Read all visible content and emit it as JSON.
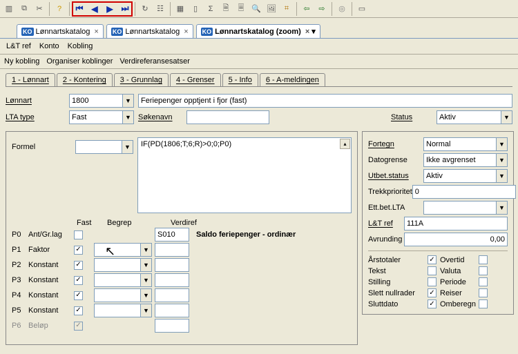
{
  "toolbar_icons": [
    "grid",
    "copy",
    "cut",
    "sep",
    "help",
    "sep",
    "first",
    "prev",
    "next",
    "last",
    "sep",
    "loop",
    "tree",
    "sep",
    "table",
    "chart",
    "sum",
    "doc",
    "page",
    "mag",
    "img",
    "bars",
    "sep",
    "back",
    "fwd",
    "sep",
    "stop",
    "sep",
    "dialog"
  ],
  "tabs": [
    {
      "label": "Lønnartskatalog",
      "active": false
    },
    {
      "label": "Lønnartskatalog",
      "active": false
    },
    {
      "label": "Lønnartskatalog (zoom)",
      "active": true
    }
  ],
  "menubar": [
    "L&T ref",
    "Konto",
    "Kobling"
  ],
  "subbar": [
    "Ny kobling",
    "Organiser koblinger",
    "Verdireferansesatser"
  ],
  "numtabs": [
    "1 - Lønnart",
    "2 - Kontering",
    "3 - Grunnlag",
    "4 - Grenser",
    "5 - Info",
    "6 - A-meldingen"
  ],
  "fields": {
    "lonnart_lbl": "Lønnart",
    "lonnart_val": "1800",
    "lonnart_desc": "Feriepenger opptjent i fjor (fast)",
    "ltatype_lbl": "LTA type",
    "ltatype_val": "Fast",
    "sokenavn_lbl": "Søkenavn",
    "sokenavn_val": "",
    "status_lbl": "Status",
    "status_val": "Aktiv",
    "formel_lbl": "Formel",
    "formel_sel": "",
    "formel_text": "IF(PD(1806;T;6;R)>0;0;P0)"
  },
  "grid_headers": {
    "fast": "Fast",
    "begrep": "Begrep",
    "verdiref": "Verdiref"
  },
  "prows": [
    {
      "code": "P0",
      "name": "Ant/Gr.lag",
      "chk": false,
      "begrep": null,
      "verdiref": "S010",
      "extra": "Saldo feriepenger - ordinær"
    },
    {
      "code": "P1",
      "name": "Faktor",
      "chk": true,
      "begrep": "",
      "verdiref": ""
    },
    {
      "code": "P2",
      "name": "Konstant",
      "chk": true,
      "begrep": "",
      "verdiref": ""
    },
    {
      "code": "P3",
      "name": "Konstant",
      "chk": true,
      "begrep": "",
      "verdiref": ""
    },
    {
      "code": "P4",
      "name": "Konstant",
      "chk": true,
      "begrep": "",
      "verdiref": ""
    },
    {
      "code": "P5",
      "name": "Konstant",
      "chk": true,
      "begrep": "",
      "verdiref": ""
    },
    {
      "code": "P6",
      "name": "Beløp",
      "chk": true,
      "grey": true,
      "begrep": null,
      "verdiref": "",
      "disabled": true
    }
  ],
  "right": {
    "fortegn_lbl": "Fortegn",
    "fortegn_val": "Normal",
    "datogrense_lbl": "Datogrense",
    "datogrense_val": "Ikke avgrenset",
    "utbet_lbl": "Utbet.status",
    "utbet_val": "Aktiv",
    "trekk_lbl": "Trekkprioritet",
    "trekk_val": "0",
    "ettbet_lbl": "Ett.bet.LTA",
    "ettbet_val": "",
    "ltref_lbl": "L&T ref",
    "ltref_val": "111A",
    "avrund_lbl": "Avrunding",
    "avrund_val": "0,00"
  },
  "checks": {
    "arstotaler": "Årstotaler",
    "arstotaler_v": true,
    "overtid": "Overtid",
    "overtid_v": false,
    "tekst": "Tekst",
    "tekst_v": false,
    "valuta": "Valuta",
    "valuta_v": false,
    "stilling": "Stilling",
    "stilling_v": false,
    "periode": "Periode",
    "periode_v": false,
    "slettnull": "Slett nullrader",
    "slettnull_v": true,
    "reiser": "Reiser",
    "reiser_v": false,
    "sluttdato": "Sluttdato",
    "sluttdato_v": true,
    "omberegn": "Omberegn",
    "omberegn_v": false
  }
}
